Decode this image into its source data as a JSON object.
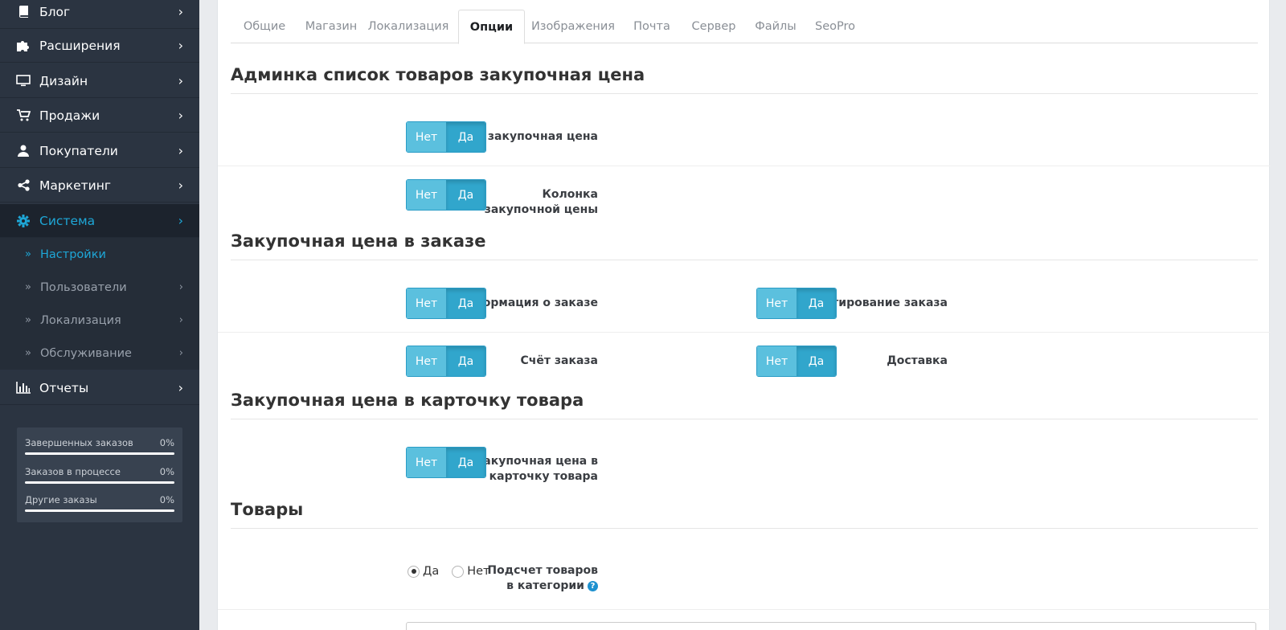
{
  "sidebar": {
    "menu": [
      {
        "label": "Блог",
        "icon": "book-icon"
      },
      {
        "label": "Расширения",
        "icon": "puzzle-icon"
      },
      {
        "label": "Дизайн",
        "icon": "monitor-icon"
      },
      {
        "label": "Продажи",
        "icon": "cart-icon"
      },
      {
        "label": "Покупатели",
        "icon": "user-icon"
      },
      {
        "label": "Маркетинг",
        "icon": "share-icon"
      },
      {
        "label": "Система",
        "icon": "gear-icon"
      },
      {
        "label": "Отчеты",
        "icon": "bar-chart-icon"
      }
    ],
    "submenu": [
      {
        "label": "Настройки"
      },
      {
        "label": "Пользователи"
      },
      {
        "label": "Локализация"
      },
      {
        "label": "Обслуживание"
      }
    ],
    "stats": [
      {
        "label": "Завершенных заказов",
        "value": "0%",
        "progress": 0
      },
      {
        "label": "Заказов в процессе",
        "value": "0%",
        "progress": 0
      },
      {
        "label": "Другие заказы",
        "value": "0%",
        "progress": 0
      }
    ]
  },
  "tabs": [
    "Общие",
    "Магазин",
    "Локализация",
    "Опции",
    "Изображения",
    "Почта",
    "Сервер",
    "Файлы",
    "SeoPro"
  ],
  "active_tab": "Опции",
  "sections": {
    "admin_list": "Админка список товаров закупочная цена",
    "order": "Закупочная цена в заказе",
    "product_card": "Закупочная цена в карточку товара",
    "products": "Товары"
  },
  "toggle": {
    "no": "Нет",
    "yes": "Да"
  },
  "fields": {
    "filter_price": {
      "label": "Фильтр закупочная цена",
      "value": "Да"
    },
    "column_price": {
      "label": "Колонка закупочной цены",
      "value": "Да"
    },
    "order_info": {
      "label": "Информация о заказе",
      "value": "Да"
    },
    "order_edit": {
      "label": "Редактирование заказа",
      "value": "Да"
    },
    "order_invoice": {
      "label": "Счёт заказа",
      "value": "Да"
    },
    "delivery": {
      "label": "Доставка",
      "value": "Да"
    },
    "card_price": {
      "label": "Закупочная цена в карточку товара",
      "value": "Да"
    },
    "category_count": {
      "label": "Подсчет товаров в категории",
      "value": "Да",
      "opt_yes": "Да",
      "opt_no": "Нет"
    }
  },
  "colors": {
    "sidebar_bg": "#2b3441",
    "accent": "#1ea7d7",
    "toggle_no": "#5bc0de",
    "toggle_yes": "#31a6cc"
  }
}
